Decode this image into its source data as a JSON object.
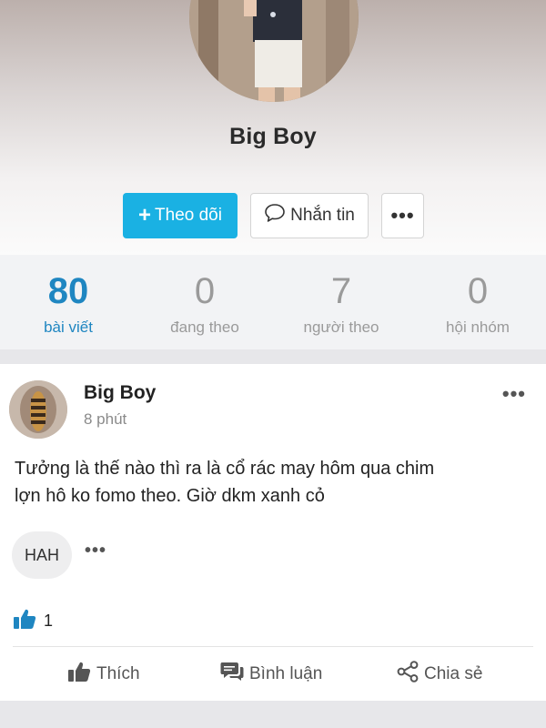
{
  "profile": {
    "name": "Big Boy"
  },
  "actions": {
    "follow_label": "Theo dõi",
    "follow_icon": "plus-icon",
    "message_label": "Nhắn tin",
    "message_icon": "speech-bubble-icon",
    "more_label": "•••"
  },
  "stats": [
    {
      "value": "80",
      "label": "bài viết",
      "active": true
    },
    {
      "value": "0",
      "label": "đang theo",
      "active": false
    },
    {
      "value": "7",
      "label": "người theo",
      "active": false
    },
    {
      "value": "0",
      "label": "hội nhóm",
      "active": false
    }
  ],
  "post": {
    "author": "Big Boy",
    "time": "8 phút",
    "menu_label": "•••",
    "text": "Tưởng là thế nào thì ra là cổ rác may hôm qua chim\nlợn hô ko fomo theo. Giờ dkm xanh cỏ",
    "tag": "HAH",
    "tag_more": "•••",
    "like_count": "1",
    "buttons": {
      "like": "Thích",
      "comment": "Bình luận",
      "share": "Chia sẻ"
    }
  },
  "colors": {
    "accent": "#1ab1e3",
    "active_stat": "#1f86c1",
    "muted": "#9a9a9a"
  }
}
